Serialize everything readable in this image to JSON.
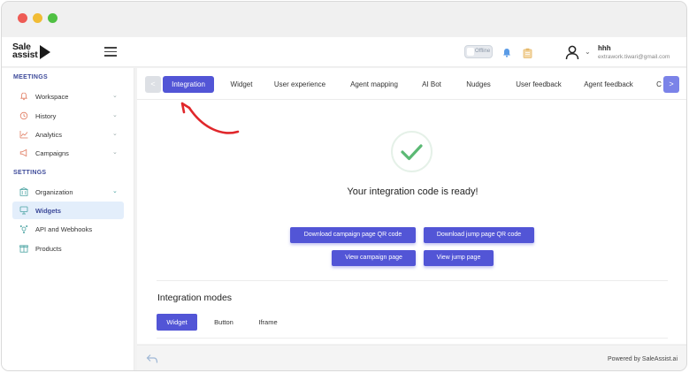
{
  "brand": {
    "line1": "Sale",
    "line2": "assist"
  },
  "header": {
    "status_toggle": "Offline",
    "user_name": "hhh",
    "user_email": "extrawork.tiwari@gmail.com"
  },
  "sidebar": {
    "section_meetings": "MEETINGS",
    "section_settings": "SETTINGS",
    "meetings_items": [
      {
        "label": "Workspace",
        "icon": "bell-icon"
      },
      {
        "label": "History",
        "icon": "history-icon"
      },
      {
        "label": "Analytics",
        "icon": "analytics-icon"
      },
      {
        "label": "Campaigns",
        "icon": "campaign-icon"
      }
    ],
    "settings_items": [
      {
        "label": "Organization",
        "icon": "organization-icon"
      },
      {
        "label": "Widgets",
        "icon": "widget-icon",
        "active": true
      },
      {
        "label": "API and Webhooks",
        "icon": "api-icon"
      },
      {
        "label": "Products",
        "icon": "products-icon"
      }
    ]
  },
  "tabs": {
    "prev": "<",
    "next": ">",
    "items": [
      "Integration",
      "Widget",
      "User experience",
      "Agent mapping",
      "AI Bot",
      "Nudges",
      "User feedback",
      "Agent feedback",
      "C"
    ],
    "active": "Integration"
  },
  "integration": {
    "ready_message": "Your integration code is ready!",
    "download_campaign_qr": "Download campaign page QR code",
    "download_jump_qr": "Download jump page QR code",
    "view_campaign": "View campaign page",
    "view_jump": "View jump page"
  },
  "modes": {
    "title": "Integration modes",
    "tabs": [
      "Widget",
      "Button",
      "Iframe"
    ],
    "active": "Widget"
  },
  "footer": {
    "powered_by": "Powered by SaleAssist.ai"
  },
  "colors": {
    "primary": "#5255d6",
    "section_heading": "#3d4a9a",
    "success": "#5bb974",
    "annotation_arrow": "#e0272b"
  }
}
